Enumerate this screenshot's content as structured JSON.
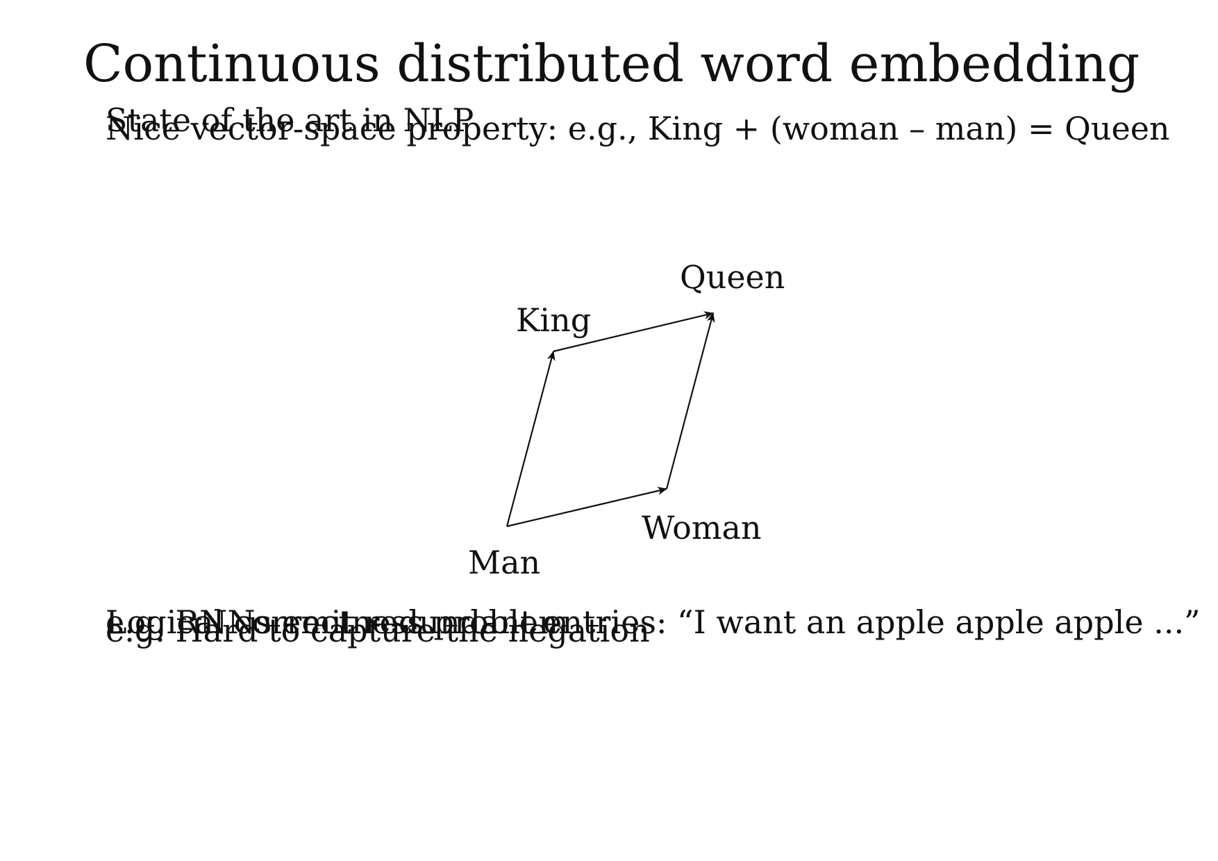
{
  "slide": {
    "title": "Continuous distributed word embedding",
    "lines": [
      "State of the art in NLP",
      "Nice vector-space property: e.g., King + (woman – man) = Queen",
      "Logical correctness problem",
      "e.g. RNNs emit redundant entries: “I want an apple apple apple ...”",
      "e.g. Hard to capture the negation"
    ]
  },
  "diagram": {
    "nodes": {
      "man": "Man",
      "woman": "Woman",
      "king": "King",
      "queen": "Queen"
    },
    "arrows": [
      {
        "from": "Man",
        "to": "King"
      },
      {
        "from": "Man",
        "to": "Woman"
      },
      {
        "from": "King",
        "to": "Queen"
      },
      {
        "from": "Woman",
        "to": "Queen"
      }
    ]
  }
}
